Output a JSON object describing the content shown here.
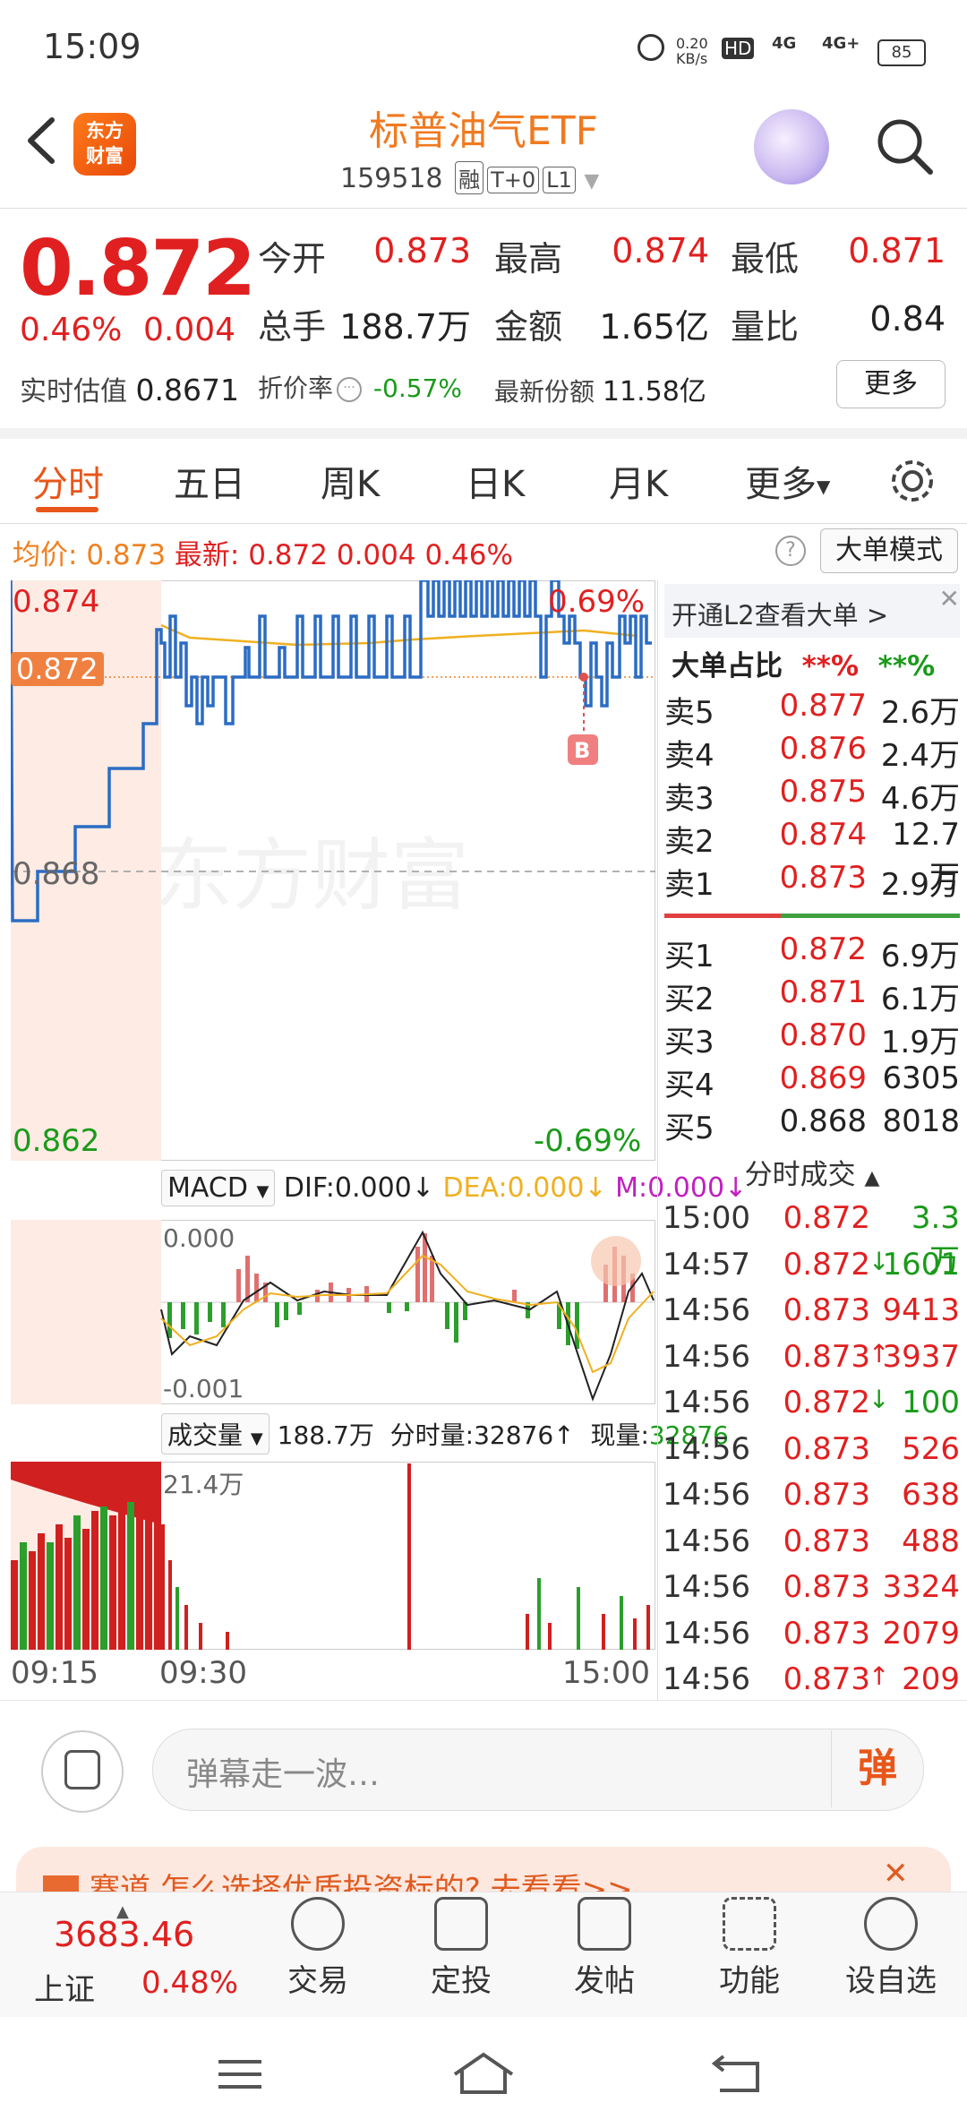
{
  "status": {
    "time": "15:09",
    "net_speed": "0.20\nKB/s",
    "hd": "HD",
    "net1": "4G",
    "net2": "4G+",
    "battery": "85"
  },
  "header": {
    "logo_text": "东方\n财富",
    "title": "标普油气ETF",
    "code": "159518",
    "tags": [
      "融",
      "T+0",
      "L1"
    ]
  },
  "quote": {
    "price": "0.872",
    "change_pct": "0.46%",
    "change": "0.004",
    "fields": [
      {
        "label": "今开",
        "value": "0.873",
        "color": "#e02020"
      },
      {
        "label": "最高",
        "value": "0.874",
        "color": "#e02020"
      },
      {
        "label": "最低",
        "value": "0.871",
        "color": "#e02020"
      },
      {
        "label": "总手",
        "value": "188.7万",
        "color": "#222222"
      },
      {
        "label": "金额",
        "value": "1.65亿",
        "color": "#222222"
      },
      {
        "label": "量比",
        "value": "0.84",
        "color": "#222222"
      }
    ],
    "estimate_label": "实时估值",
    "estimate_value": "0.8671",
    "discount_label": "折价率",
    "discount_value": "-0.57%",
    "shares_label": "最新份额",
    "shares_value": "11.58亿",
    "more_label": "更多"
  },
  "tabs": [
    "分时",
    "五日",
    "周K",
    "日K",
    "月K",
    "更多"
  ],
  "infobar": {
    "avg_label": "均价:",
    "avg_value": "0.873",
    "last_label": "最新:",
    "last_value": "0.872",
    "chg": "0.004",
    "pct": "0.46%",
    "mode_button": "大单模式",
    "help": "?"
  },
  "chart": {
    "y_top": "0.874",
    "y_mid": "0.868",
    "y_bottom": "0.862",
    "y_cur": "0.872",
    "pct_top": "0.69%",
    "pct_bottom": "-0.69%",
    "marker": "B",
    "watermark": "东方财富",
    "x_labels": [
      "09:15",
      "09:30",
      "15:00"
    ]
  },
  "macd": {
    "name": "MACD",
    "dif": "DIF:0.000↓",
    "dea": "DEA:0.000↓",
    "m": "M:0.000↓",
    "top": "0.000",
    "bottom": "-0.001"
  },
  "volume": {
    "name": "成交量",
    "total": "188.7万",
    "fs_label": "分时量:32876↑",
    "now_label": "现量:",
    "now_value": "32876",
    "top": "21.4万"
  },
  "orderbook": {
    "promo": "开通L2查看大单 >",
    "ratio_label": "大单占比",
    "ratio_sell": "**%",
    "ratio_buy": "**%",
    "asks": [
      {
        "label": "卖5",
        "price": "0.877",
        "vol": "2.6万"
      },
      {
        "label": "卖4",
        "price": "0.876",
        "vol": "2.4万"
      },
      {
        "label": "卖3",
        "price": "0.875",
        "vol": "4.6万"
      },
      {
        "label": "卖2",
        "price": "0.874",
        "vol": "12.7万"
      },
      {
        "label": "卖1",
        "price": "0.873",
        "vol": "2.9万"
      }
    ],
    "bids": [
      {
        "label": "买1",
        "price": "0.872",
        "vol": "6.9万",
        "pcolor": "#e02020"
      },
      {
        "label": "买2",
        "price": "0.871",
        "vol": "6.1万",
        "pcolor": "#e02020"
      },
      {
        "label": "买3",
        "price": "0.870",
        "vol": "1.9万",
        "pcolor": "#e02020"
      },
      {
        "label": "买4",
        "price": "0.869",
        "vol": "6305",
        "pcolor": "#e02020"
      },
      {
        "label": "买5",
        "price": "0.868",
        "vol": "8018",
        "pcolor": "#222222"
      }
    ],
    "ticks_title": "分时成交",
    "ticks": [
      {
        "t": "15:00",
        "p": "0.872",
        "v": "3.3万",
        "vc": "#1a9a1a",
        "arrow": ""
      },
      {
        "t": "14:57",
        "p": "0.872",
        "v": "1601",
        "vc": "#1a9a1a",
        "arrow": "↓"
      },
      {
        "t": "14:56",
        "p": "0.873",
        "v": "9413",
        "vc": "#e02020",
        "arrow": ""
      },
      {
        "t": "14:56",
        "p": "0.873",
        "v": "3937",
        "vc": "#e02020",
        "arrow": "↑"
      },
      {
        "t": "14:56",
        "p": "0.872",
        "v": "100",
        "vc": "#1a9a1a",
        "arrow": "↓"
      },
      {
        "t": "14:56",
        "p": "0.873",
        "v": "526",
        "vc": "#e02020",
        "arrow": ""
      },
      {
        "t": "14:56",
        "p": "0.873",
        "v": "638",
        "vc": "#e02020",
        "arrow": ""
      },
      {
        "t": "14:56",
        "p": "0.873",
        "v": "488",
        "vc": "#e02020",
        "arrow": ""
      },
      {
        "t": "14:56",
        "p": "0.873",
        "v": "3324",
        "vc": "#e02020",
        "arrow": ""
      },
      {
        "t": "14:56",
        "p": "0.873",
        "v": "2079",
        "vc": "#e02020",
        "arrow": ""
      },
      {
        "t": "14:56",
        "p": "0.873",
        "v": "209",
        "vc": "#e02020",
        "arrow": "↑"
      }
    ]
  },
  "danmu": {
    "placeholder": "弹幕走一波…",
    "button": "弹"
  },
  "banner": {
    "text": "赛道 怎么选择优质投资标的? 去看看>>"
  },
  "bottomnav": {
    "index_value": "3683.46",
    "index_name": "上证",
    "index_pct": "0.48%",
    "items": [
      "交易",
      "定投",
      "发帖",
      "功能",
      "设自选"
    ]
  }
}
